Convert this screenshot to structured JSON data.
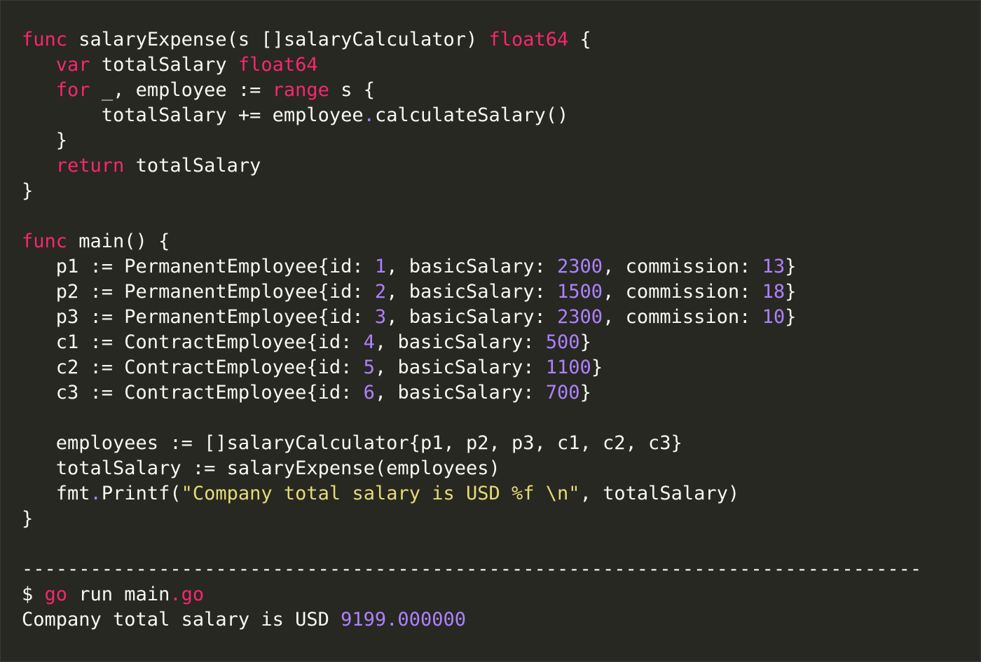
{
  "code": {
    "lines": [
      [
        {
          "t": "kw",
          "v": "func"
        },
        {
          "t": "pl",
          "v": " salaryExpense(s []salaryCalculator) "
        },
        {
          "t": "kw",
          "v": "float64"
        },
        {
          "t": "pl",
          "v": " {"
        }
      ],
      [
        {
          "t": "pl",
          "v": "   "
        },
        {
          "t": "kw",
          "v": "var"
        },
        {
          "t": "pl",
          "v": " totalSalary "
        },
        {
          "t": "kw",
          "v": "float64"
        }
      ],
      [
        {
          "t": "pl",
          "v": "   "
        },
        {
          "t": "kw",
          "v": "for"
        },
        {
          "t": "pl",
          "v": " _, employee := "
        },
        {
          "t": "kw",
          "v": "range"
        },
        {
          "t": "pl",
          "v": " s {"
        }
      ],
      [
        {
          "t": "pl",
          "v": "       totalSalary += employee"
        },
        {
          "t": "dot",
          "v": "."
        },
        {
          "t": "pl",
          "v": "calculateSalary()"
        }
      ],
      [
        {
          "t": "pl",
          "v": "   }"
        }
      ],
      [
        {
          "t": "pl",
          "v": "   "
        },
        {
          "t": "kw",
          "v": "return"
        },
        {
          "t": "pl",
          "v": " totalSalary"
        }
      ],
      [
        {
          "t": "pl",
          "v": "}"
        }
      ],
      [],
      [
        {
          "t": "kw",
          "v": "func"
        },
        {
          "t": "pl",
          "v": " main() {"
        }
      ],
      [
        {
          "t": "pl",
          "v": "   p1 := PermanentEmployee{id: "
        },
        {
          "t": "num",
          "v": "1"
        },
        {
          "t": "pl",
          "v": ", basicSalary: "
        },
        {
          "t": "num",
          "v": "2300"
        },
        {
          "t": "pl",
          "v": ", commission: "
        },
        {
          "t": "num",
          "v": "13"
        },
        {
          "t": "pl",
          "v": "}"
        }
      ],
      [
        {
          "t": "pl",
          "v": "   p2 := PermanentEmployee{id: "
        },
        {
          "t": "num",
          "v": "2"
        },
        {
          "t": "pl",
          "v": ", basicSalary: "
        },
        {
          "t": "num",
          "v": "1500"
        },
        {
          "t": "pl",
          "v": ", commission: "
        },
        {
          "t": "num",
          "v": "18"
        },
        {
          "t": "pl",
          "v": "}"
        }
      ],
      [
        {
          "t": "pl",
          "v": "   p3 := PermanentEmployee{id: "
        },
        {
          "t": "num",
          "v": "3"
        },
        {
          "t": "pl",
          "v": ", basicSalary: "
        },
        {
          "t": "num",
          "v": "2300"
        },
        {
          "t": "pl",
          "v": ", commission: "
        },
        {
          "t": "num",
          "v": "10"
        },
        {
          "t": "pl",
          "v": "}"
        }
      ],
      [
        {
          "t": "pl",
          "v": "   c1 := ContractEmployee{id: "
        },
        {
          "t": "num",
          "v": "4"
        },
        {
          "t": "pl",
          "v": ", basicSalary: "
        },
        {
          "t": "num",
          "v": "500"
        },
        {
          "t": "pl",
          "v": "}"
        }
      ],
      [
        {
          "t": "pl",
          "v": "   c2 := ContractEmployee{id: "
        },
        {
          "t": "num",
          "v": "5"
        },
        {
          "t": "pl",
          "v": ", basicSalary: "
        },
        {
          "t": "num",
          "v": "1100"
        },
        {
          "t": "pl",
          "v": "}"
        }
      ],
      [
        {
          "t": "pl",
          "v": "   c3 := ContractEmployee{id: "
        },
        {
          "t": "num",
          "v": "6"
        },
        {
          "t": "pl",
          "v": ", basicSalary: "
        },
        {
          "t": "num",
          "v": "700"
        },
        {
          "t": "pl",
          "v": "}"
        }
      ],
      [],
      [
        {
          "t": "pl",
          "v": "   employees := []salaryCalculator{p1, p2, p3, c1, c2, c3}"
        }
      ],
      [
        {
          "t": "pl",
          "v": "   totalSalary := salaryExpense(employees)"
        }
      ],
      [
        {
          "t": "pl",
          "v": "   fmt"
        },
        {
          "t": "dot",
          "v": "."
        },
        {
          "t": "pl",
          "v": "Printf("
        },
        {
          "t": "str",
          "v": "\"Company total salary is USD %f \\n\""
        },
        {
          "t": "pl",
          "v": ", totalSalary)"
        }
      ],
      [
        {
          "t": "pl",
          "v": "}"
        }
      ],
      [],
      [
        {
          "t": "pl",
          "v": "-------------------------------------------------------------------------------"
        }
      ],
      [
        {
          "t": "pl",
          "v": "$ "
        },
        {
          "t": "kw",
          "v": "go"
        },
        {
          "t": "pl",
          "v": " run main"
        },
        {
          "t": "kw",
          "v": ".go"
        }
      ],
      [
        {
          "t": "pl",
          "v": "Company total salary is USD "
        },
        {
          "t": "num",
          "v": "9199.000000"
        }
      ]
    ]
  },
  "colors": {
    "background": "#272822",
    "keyword": "#f92672",
    "number": "#ae81ff",
    "string": "#e6db74",
    "text": "#f8f8f2"
  }
}
